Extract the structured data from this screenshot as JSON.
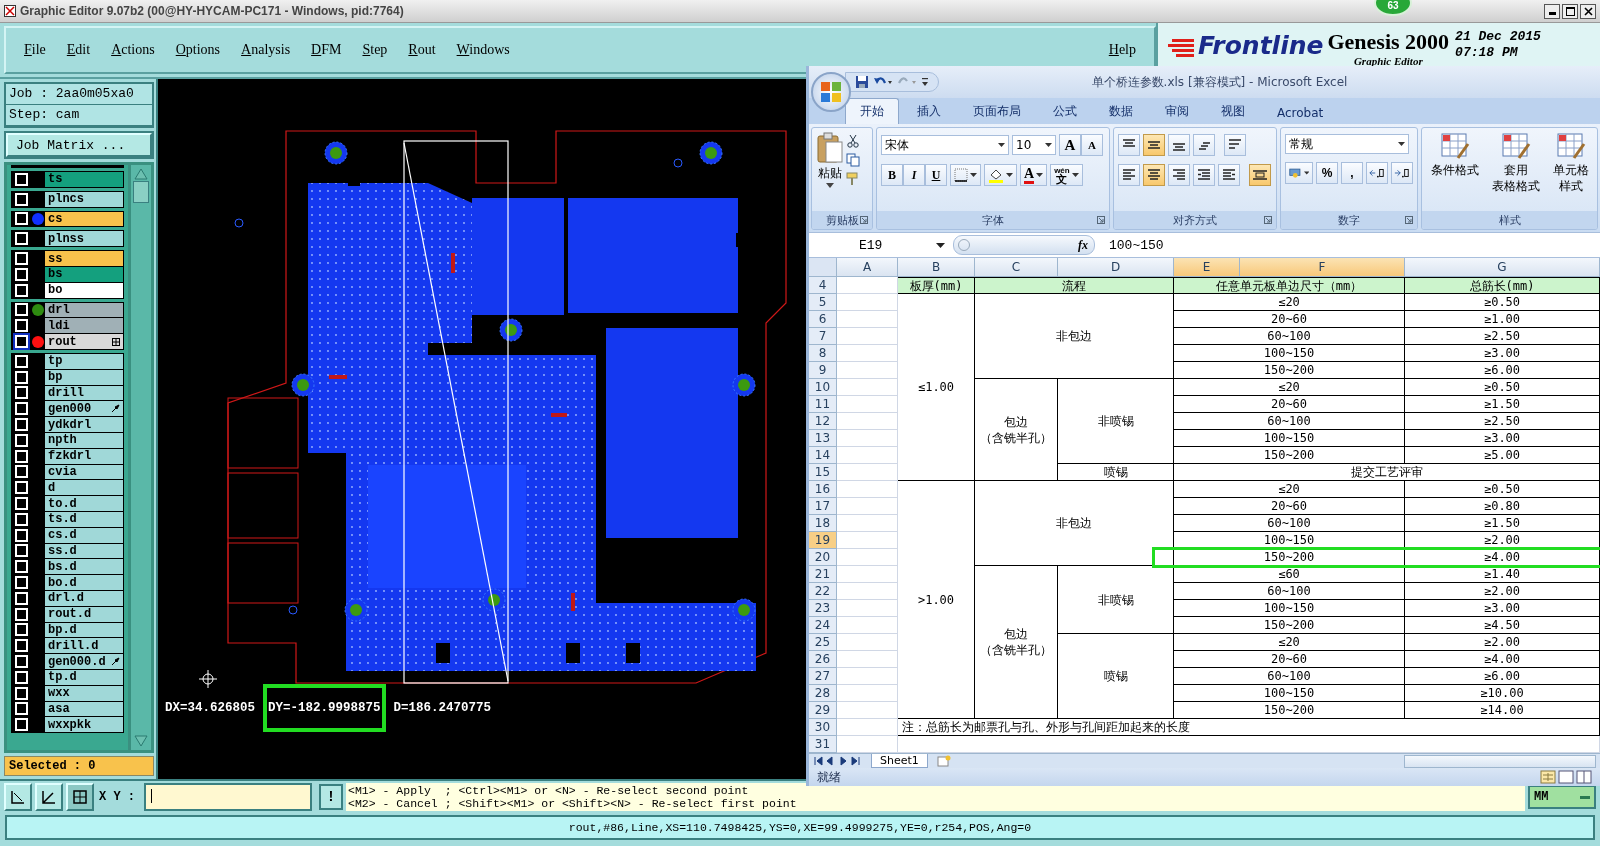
{
  "genesis": {
    "title": "Graphic Editor 9.07b2 (00@HY-HYCAM-PC171 - Windows, pid:7764)",
    "badge": "63",
    "menu": [
      "File",
      "Edit",
      "Actions",
      "Options",
      "Analysis",
      "DFM",
      "Step",
      "Rout",
      "Windows"
    ],
    "help": "Help",
    "brand": {
      "company": "Frontline",
      "product": "Genesis 2000",
      "subtitle": "Graphic Editor",
      "date": "21 Dec 2015",
      "time": "07:18 PM"
    },
    "job": "Job : 2aa0m05xa0",
    "step": "Step: cam",
    "matrix_button": "Job Matrix ...",
    "layer_groups": [
      {
        "layers": [
          {
            "name": "ts",
            "color": "#14a07e",
            "active": false,
            "kind": "plain"
          }
        ]
      },
      {
        "layers": [
          {
            "name": "plncs",
            "color": "#a0d8d8",
            "active": false,
            "kind": "plain"
          }
        ]
      },
      {
        "layers": [
          {
            "name": "cs",
            "color": "#f8c24c",
            "dot": {
              "color": "#1030ff"
            },
            "active": false,
            "kind": "plain"
          }
        ]
      },
      {
        "layers": [
          {
            "name": "plnss",
            "color": "#a0d8d8",
            "active": false,
            "kind": "plain"
          }
        ]
      },
      {
        "layers": [
          {
            "name": "ss",
            "color": "#f8c24c",
            "active": false,
            "kind": "plain"
          },
          {
            "name": "bs",
            "color": "#14a07e",
            "active": false,
            "kind": "plain"
          },
          {
            "name": "bo",
            "color": "#ffffff",
            "active": false,
            "kind": "plain"
          }
        ]
      },
      {
        "layers": [
          {
            "name": "drl",
            "color": "#a0b0b6",
            "dot": {
              "color": "#2e8b10"
            },
            "active": false,
            "kind": "plain"
          },
          {
            "name": "ldi",
            "color": "#a0b0b6",
            "active": false,
            "kind": "plain"
          },
          {
            "name": "rout",
            "color": "#d8d8d8",
            "dot": {
              "color": "#ff1010"
            },
            "active": true,
            "kind": "grid"
          }
        ]
      },
      {
        "layers": [
          {
            "name": "tp",
            "color": "#a0d8d8",
            "active": false,
            "kind": "plain"
          },
          {
            "name": "bp",
            "color": "#a0d8d8",
            "active": false,
            "kind": "plain"
          },
          {
            "name": "drill",
            "color": "#a0d8d8",
            "active": false,
            "kind": "plain"
          },
          {
            "name": "gen000",
            "color": "#a0d8d8",
            "active": false,
            "kind": "hand"
          },
          {
            "name": "ydkdrl",
            "color": "#a0d8d8",
            "active": false,
            "kind": "plain"
          },
          {
            "name": "npth",
            "color": "#a0d8d8",
            "active": false,
            "kind": "plain"
          },
          {
            "name": "fzkdrl",
            "color": "#a0d8d8",
            "active": false,
            "kind": "plain"
          },
          {
            "name": "cvia",
            "color": "#a0d8d8",
            "active": false,
            "kind": "plain"
          },
          {
            "name": "d",
            "color": "#a0d8d8",
            "active": false,
            "kind": "plain"
          },
          {
            "name": "to.d",
            "color": "#a0d8d8",
            "active": false,
            "kind": "plain"
          },
          {
            "name": "ts.d",
            "color": "#a0d8d8",
            "active": false,
            "kind": "plain"
          },
          {
            "name": "cs.d",
            "color": "#a0d8d8",
            "active": false,
            "kind": "plain"
          },
          {
            "name": "ss.d",
            "color": "#a0d8d8",
            "active": false,
            "kind": "plain"
          },
          {
            "name": "bs.d",
            "color": "#a0d8d8",
            "active": false,
            "kind": "plain"
          },
          {
            "name": "bo.d",
            "color": "#a0d8d8",
            "active": false,
            "kind": "plain"
          },
          {
            "name": "drl.d",
            "color": "#a0d8d8",
            "active": false,
            "kind": "plain"
          },
          {
            "name": "rout.d",
            "color": "#a0d8d8",
            "active": false,
            "kind": "plain"
          },
          {
            "name": "bp.d",
            "color": "#a0d8d8",
            "active": false,
            "kind": "plain"
          },
          {
            "name": "drill.d",
            "color": "#a0d8d8",
            "active": false,
            "kind": "plain"
          },
          {
            "name": "gen000.d",
            "color": "#a0d8d8",
            "active": false,
            "kind": "hand"
          },
          {
            "name": "tp.d",
            "color": "#a0d8d8",
            "active": false,
            "kind": "plain"
          },
          {
            "name": "wxx",
            "color": "#a0d8d8",
            "active": false,
            "kind": "plain"
          },
          {
            "name": "asa",
            "color": "#a0d8d8",
            "active": false,
            "kind": "plain"
          },
          {
            "name": "wxxpkk",
            "color": "#a0d8d8",
            "active": false,
            "kind": "plain"
          }
        ]
      }
    ],
    "selected_count": "Selected : 0",
    "measurements": [
      {
        "text": "DX=34.626805",
        "highlighted": false
      },
      {
        "text": "DY=-182.9998875",
        "highlighted": true
      },
      {
        "text": "D=186.2470775",
        "highlighted": false
      }
    ],
    "xy_label": "X Y :",
    "prompt_button": "!",
    "hints": [
      "<M1> - Apply  ; <Ctrl><M1> or <N> - Re-select second point",
      "<M2> - Cancel ; <Shift><M1> or <Shift><N> - Re-select first point"
    ],
    "units": "MM",
    "status": "rout,#86,Line,XS=110.7498425,YS=0,XE=99.4999275,YE=0,r254,POS,Ang=0"
  },
  "excel": {
    "title": "单个桥连参数.xls  [兼容模式] - Microsoft Excel",
    "tabs": [
      {
        "label": "开始",
        "selected": true
      },
      {
        "label": "插入",
        "selected": false
      },
      {
        "label": "页面布局",
        "selected": false
      },
      {
        "label": "公式",
        "selected": false
      },
      {
        "label": "数据",
        "selected": false
      },
      {
        "label": "审阅",
        "selected": false
      },
      {
        "label": "视图",
        "selected": false
      },
      {
        "label": "Acrobat",
        "selected": false
      }
    ],
    "clipboard": {
      "paste": "粘贴",
      "label": "剪贴板"
    },
    "font": {
      "name": "宋体",
      "size": "10",
      "grow": "A",
      "shrink": "A",
      "bold": "B",
      "italic": "I",
      "underline": "U",
      "color_letter": "A",
      "phonetic_top": "wén",
      "phonetic_bottom": "文",
      "label": "字体"
    },
    "alignment": {
      "label": "对齐方式",
      "rows": [
        [
          {
            "kind": "top",
            "selected": false
          },
          {
            "kind": "middle",
            "selected": true
          },
          {
            "kind": "bottom",
            "selected": false
          },
          {
            "kind": "orientation",
            "selected": false
          },
          {
            "kind": "wrap",
            "selected": false
          }
        ],
        [
          {
            "kind": "left",
            "selected": false
          },
          {
            "kind": "center",
            "selected": true
          },
          {
            "kind": "right",
            "selected": false
          },
          {
            "kind": "outdent",
            "selected": false
          },
          {
            "kind": "indent",
            "selected": false
          },
          {
            "kind": "merge",
            "selected": true
          }
        ]
      ]
    },
    "number": {
      "format": "常规",
      "percent": "%",
      "comma": ",",
      "label": "数字"
    },
    "styles": {
      "label": "样式",
      "buttons": [
        [
          "条件格式"
        ],
        [
          "套用",
          "表格格式"
        ],
        [
          "单元格",
          "样式"
        ]
      ]
    },
    "name_box": "E19",
    "function_label": "fx",
    "formula": "100~150",
    "columns": [
      {
        "label": "A",
        "selected": false
      },
      {
        "label": "B",
        "selected": false
      },
      {
        "label": "C",
        "selected": false
      },
      {
        "label": "D",
        "selected": false
      },
      {
        "label": "E",
        "selected": true
      },
      {
        "label": "F",
        "selected": true
      },
      {
        "label": "G",
        "selected": false
      }
    ],
    "row_numbers": [
      {
        "label": "4",
        "selected": false
      },
      {
        "label": "5",
        "selected": false
      },
      {
        "label": "6",
        "selected": false
      },
      {
        "label": "7",
        "selected": false
      },
      {
        "label": "8",
        "selected": false
      },
      {
        "label": "9",
        "selected": false
      },
      {
        "label": "10",
        "selected": false
      },
      {
        "label": "11",
        "selected": false
      },
      {
        "label": "12",
        "selected": false
      },
      {
        "label": "13",
        "selected": false
      },
      {
        "label": "14",
        "selected": false
      },
      {
        "label": "15",
        "selected": false
      },
      {
        "label": "16",
        "selected": false
      },
      {
        "label": "17",
        "selected": false
      },
      {
        "label": "18",
        "selected": false
      },
      {
        "label": "19",
        "selected": true
      },
      {
        "label": "20",
        "selected": false
      },
      {
        "label": "21",
        "selected": false
      },
      {
        "label": "22",
        "selected": false
      },
      {
        "label": "23",
        "selected": false
      },
      {
        "label": "24",
        "selected": false
      },
      {
        "label": "25",
        "selected": false
      },
      {
        "label": "26",
        "selected": false
      },
      {
        "label": "27",
        "selected": false
      },
      {
        "label": "28",
        "selected": false
      },
      {
        "label": "29",
        "selected": false
      },
      {
        "label": "30",
        "selected": false
      },
      {
        "label": "31",
        "selected": false
      }
    ],
    "header": {
      "thickness": "板厚(mm)",
      "process": "流程",
      "size": "任意单元板单边尺寸（mm）",
      "length": "总筋长(mm)"
    },
    "groups": [
      {
        "thickness": "≤1.00",
        "processes": [
          {
            "label": [
              "非包边"
            ],
            "variants": [
              {
                "ranges": [
                  {
                    "size": "≤20",
                    "length": "≥0.50",
                    "highlighted": false
                  },
                  {
                    "size": "20~60",
                    "length": "≥1.00",
                    "highlighted": false
                  },
                  {
                    "size": "60~100",
                    "length": "≥2.50",
                    "highlighted": false
                  },
                  {
                    "size": "100~150",
                    "length": "≥3.00",
                    "highlighted": false
                  },
                  {
                    "size": "150~200",
                    "length": "≥6.00",
                    "highlighted": false
                  }
                ]
              }
            ]
          },
          {
            "label": [
              "包边",
              "（含铣半孔）"
            ],
            "variants": [
              {
                "label": "非喷锡",
                "ranges": [
                  {
                    "size": "≤20",
                    "length": "≥0.50",
                    "highlighted": false
                  },
                  {
                    "size": "20~60",
                    "length": "≥1.50",
                    "highlighted": false
                  },
                  {
                    "size": "60~100",
                    "length": "≥2.50",
                    "highlighted": false
                  },
                  {
                    "size": "100~150",
                    "length": "≥3.00",
                    "highlighted": false
                  },
                  {
                    "size": "150~200",
                    "length": "≥5.00",
                    "highlighted": false
                  }
                ]
              },
              {
                "label": "喷锡",
                "note": "提交工艺评审"
              }
            ]
          }
        ]
      },
      {
        "thickness": ">1.00",
        "processes": [
          {
            "label": [
              "非包边"
            ],
            "variants": [
              {
                "ranges": [
                  {
                    "size": "≤20",
                    "length": "≥0.50",
                    "highlighted": false
                  },
                  {
                    "size": "20~60",
                    "length": "≥0.80",
                    "highlighted": false
                  },
                  {
                    "size": "60~100",
                    "length": "≥1.50",
                    "highlighted": false
                  },
                  {
                    "size": "100~150",
                    "length": "≥2.00",
                    "highlighted": false
                  },
                  {
                    "size": "150~200",
                    "length": "≥4.00",
                    "highlighted": true
                  }
                ]
              }
            ]
          },
          {
            "label": [
              "包边",
              "（含铣半孔）"
            ],
            "variants": [
              {
                "label": "非喷锡",
                "ranges": [
                  {
                    "size": "≤60",
                    "length": "≥1.40",
                    "highlighted": false
                  },
                  {
                    "size": "60~100",
                    "length": "≥2.00",
                    "highlighted": false
                  },
                  {
                    "size": "100~150",
                    "length": "≥3.00",
                    "highlighted": false
                  },
                  {
                    "size": "150~200",
                    "length": "≥4.50",
                    "highlighted": false
                  }
                ]
              },
              {
                "label": "喷锡",
                "ranges": [
                  {
                    "size": "≤20",
                    "length": "≥2.00",
                    "highlighted": false
                  },
                  {
                    "size": "20~60",
                    "length": "≥4.00",
                    "highlighted": false
                  },
                  {
                    "size": "60~100",
                    "length": "≥6.00",
                    "highlighted": false
                  },
                  {
                    "size": "100~150",
                    "length": "≥10.00",
                    "highlighted": false
                  },
                  {
                    "size": "150~200",
                    "length": "≥14.00",
                    "highlighted": false
                  }
                ]
              }
            ]
          }
        ]
      }
    ],
    "note": "注：总筋长为邮票孔与孔、外形与孔间距加起来的长度",
    "sheet_tab": "Sheet1",
    "status": "就绪"
  }
}
